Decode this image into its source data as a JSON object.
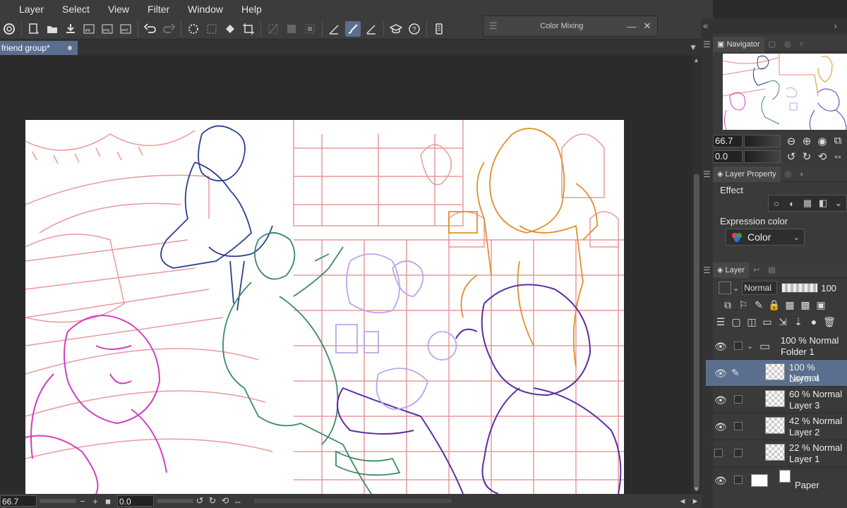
{
  "menu": [
    "Layer",
    "Select",
    "View",
    "Filter",
    "Window",
    "Help"
  ],
  "color_mixing": {
    "title": "Color Mixing"
  },
  "document_tab": {
    "label": "friend group*"
  },
  "status": {
    "zoom": "66.7",
    "rotation": "0.0"
  },
  "navigator": {
    "tab_label": "Navigator",
    "zoom": "66.7",
    "rotation": "0.0"
  },
  "layer_property": {
    "tab_label": "Layer Property",
    "effect_label": "Effect",
    "expression_color_label": "Expression color",
    "expression_color_value": "Color"
  },
  "layer_panel": {
    "tab_label": "Layer",
    "blend_mode": "Normal",
    "opacity": "100",
    "layers": [
      {
        "opacity_mode": "100 % Normal",
        "name": "Folder 1",
        "type": "folder",
        "visible": true,
        "selected": false
      },
      {
        "opacity_mode": "100 % Normal",
        "name": "Layer 4",
        "type": "raster",
        "visible": true,
        "selected": true
      },
      {
        "opacity_mode": "60 % Normal",
        "name": "Layer 3",
        "type": "raster",
        "visible": true,
        "selected": false
      },
      {
        "opacity_mode": "42 % Normal",
        "name": "Layer 2",
        "type": "raster",
        "visible": true,
        "selected": false
      },
      {
        "opacity_mode": "22 % Normal",
        "name": "Layer 1",
        "type": "raster",
        "visible": false,
        "selected": false
      },
      {
        "opacity_mode": "",
        "name": "Paper",
        "type": "paper",
        "visible": true,
        "selected": false
      }
    ]
  },
  "colors": {
    "selection": "#5a6f8e",
    "sketch_red": "#e8878a",
    "sketch_blue": "#2a3f8f",
    "sketch_green": "#3b8a6a",
    "sketch_orange": "#e0902c",
    "sketch_magenta": "#d23fc0",
    "sketch_purple": "#5a2ea6",
    "sketch_lavender": "#b9a6e8"
  }
}
